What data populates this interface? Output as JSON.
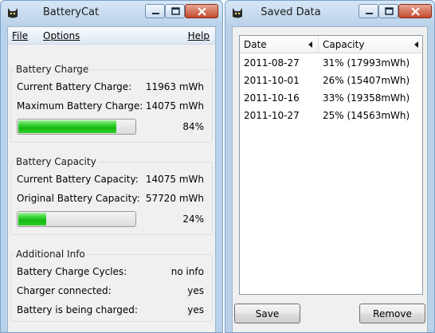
{
  "main_window": {
    "title": "BatteryCat",
    "menu": {
      "file": "File",
      "options": "Options",
      "help": "Help"
    },
    "battery_charge": {
      "legend": "Battery Charge",
      "current_label": "Current Battery Charge:",
      "current_value": "11963 mWh",
      "max_label": "Maximum Battery Charge:",
      "max_value": "14075 mWh",
      "percent_label": "84%",
      "percent": 0.84
    },
    "battery_capacity": {
      "legend": "Battery Capacity",
      "current_label": "Current Battery Capacity:",
      "current_value": "14075 mWh",
      "original_label": "Original Battery Capacity:",
      "original_value": "57720 mWh",
      "percent_label": "24%",
      "percent": 0.24
    },
    "additional_info": {
      "legend": "Additional Info",
      "cycles_label": "Battery Charge Cycles:",
      "cycles_value": "no info",
      "charger_label": "Charger connected:",
      "charger_value": "yes",
      "charging_label": "Battery is being charged:",
      "charging_value": "yes"
    }
  },
  "saved_window": {
    "title": "Saved Data",
    "columns": [
      "Date",
      "Capacity"
    ],
    "rows": [
      {
        "date": "2011-08-27",
        "capacity": "31% (17993mWh)"
      },
      {
        "date": "2011-10-01",
        "capacity": "26% (15407mWh)"
      },
      {
        "date": "2011-10-16",
        "capacity": "33% (19358mWh)"
      },
      {
        "date": "2011-10-27",
        "capacity": "25% (14563mWh)"
      }
    ],
    "save_label": "Save",
    "remove_label": "Remove"
  },
  "icons": {
    "app": "cat-icon",
    "minimize": "minimize-icon",
    "maximize": "maximize-icon",
    "close": "close-icon",
    "sort": "sort-arrow-icon"
  },
  "colors": {
    "progress_green": "#16b912",
    "window_frame": "#b9d2ea",
    "close_button": "#c24a2e"
  }
}
